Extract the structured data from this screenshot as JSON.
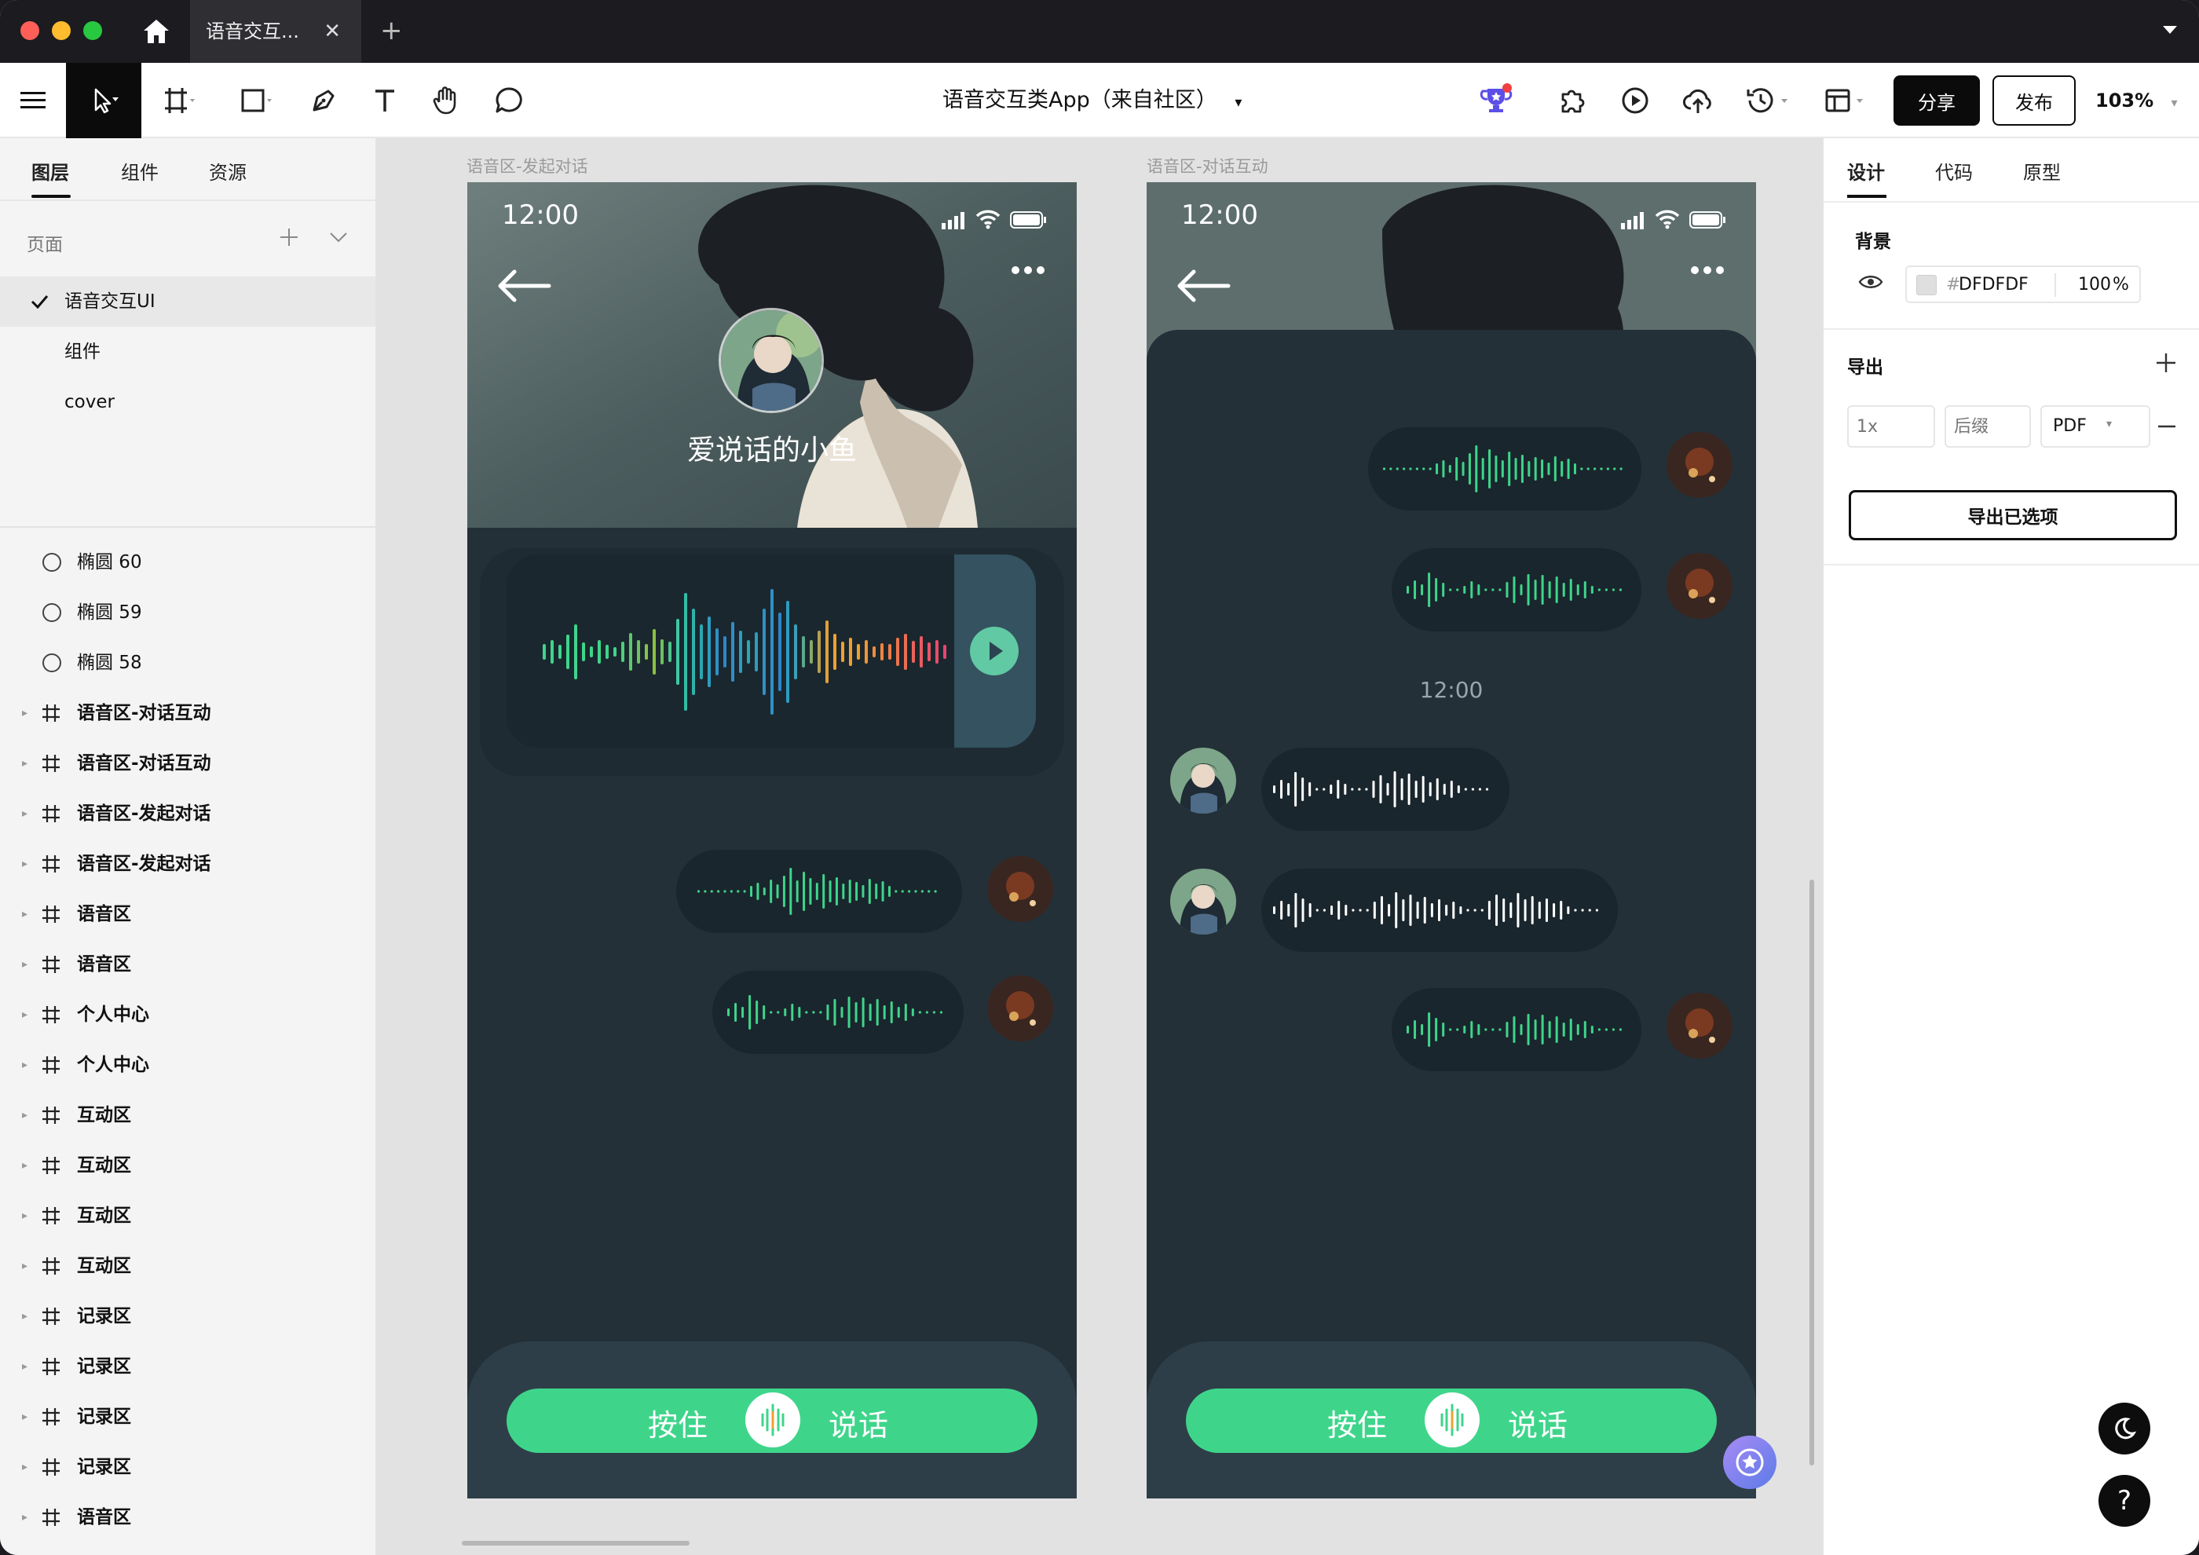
{
  "window": {
    "tab_title": "语音交互...",
    "tab_close": "✕",
    "new_tab": "+"
  },
  "toolbar": {
    "doc_title": "语音交互类App（来自社区）",
    "doc_caret": "▾",
    "share": "分享",
    "publish": "发布",
    "zoom": "103%",
    "zoom_caret": "▾"
  },
  "left_panel": {
    "tabs": [
      "图层",
      "组件",
      "资源"
    ],
    "pages_title": "页面",
    "pages": [
      {
        "label": "语音交互UI",
        "selected": true
      },
      {
        "label": "组件",
        "selected": false
      },
      {
        "label": "cover",
        "selected": false
      }
    ],
    "layers": [
      {
        "type": "ellipse",
        "label": "椭圆 60"
      },
      {
        "type": "ellipse",
        "label": "椭圆 59"
      },
      {
        "type": "ellipse",
        "label": "椭圆 58"
      },
      {
        "type": "frame",
        "label": "语音区-对话互动"
      },
      {
        "type": "frame",
        "label": "语音区-对话互动"
      },
      {
        "type": "frame",
        "label": "语音区-发起对话"
      },
      {
        "type": "frame",
        "label": "语音区-发起对话"
      },
      {
        "type": "frame",
        "label": "语音区"
      },
      {
        "type": "frame",
        "label": "语音区"
      },
      {
        "type": "frame",
        "label": "个人中心"
      },
      {
        "type": "frame",
        "label": "个人中心"
      },
      {
        "type": "frame",
        "label": "互动区"
      },
      {
        "type": "frame",
        "label": "互动区"
      },
      {
        "type": "frame",
        "label": "互动区"
      },
      {
        "type": "frame",
        "label": "互动区"
      },
      {
        "type": "frame",
        "label": "记录区"
      },
      {
        "type": "frame",
        "label": "记录区"
      },
      {
        "type": "frame",
        "label": "记录区"
      },
      {
        "type": "frame",
        "label": "记录区"
      },
      {
        "type": "frame",
        "label": "语音区"
      }
    ]
  },
  "right_panel": {
    "tabs": [
      "设计",
      "代码",
      "原型"
    ],
    "background": {
      "title": "背景",
      "hex_prefix": "#",
      "hex": "DFDFDF",
      "opacity": "100",
      "opacity_unit": "%",
      "swatch": "#DFDFDF"
    },
    "export": {
      "title": "导出",
      "scale_placeholder": "1x",
      "suffix_placeholder": "后缀",
      "format": "PDF",
      "format_caret": "▾",
      "button": "导出已选项"
    }
  },
  "canvas": {
    "frame1": {
      "label": "语音区-发起对话",
      "time": "12:00",
      "username": "爱说话的小鱼",
      "hold": "按住",
      "speak": "说话"
    },
    "frame2": {
      "label": "语音区-对话互动",
      "time": "12:00",
      "msg_time": "12:00",
      "hold": "按住",
      "speak": "说话"
    }
  },
  "help": {
    "label": "?"
  },
  "colors": {
    "accent_green": "#3ed58b",
    "app_dark": "#233038",
    "bubble": "#1a262d"
  }
}
